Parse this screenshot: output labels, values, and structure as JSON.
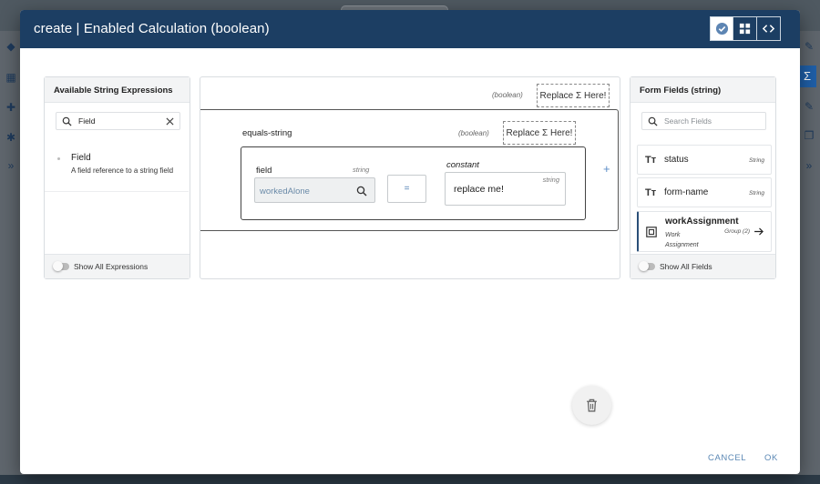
{
  "dialog": {
    "title": "create | Enabled Calculation (boolean)",
    "header_buttons": [
      {
        "icon": "check-circle-icon",
        "active": true
      },
      {
        "icon": "grid-icon",
        "active": false
      },
      {
        "icon": "code-icon",
        "active": false
      }
    ],
    "footer": {
      "cancel_label": "CANCEL",
      "ok_label": "OK"
    }
  },
  "left_panel": {
    "title": "Available String Expressions",
    "search_value": "Field",
    "items": [
      {
        "name": "Field",
        "description": "A field reference to a string field"
      }
    ],
    "toggle_label": "Show All Expressions"
  },
  "center": {
    "outer_type": "(boolean)",
    "outer_replace_label": "Replace Σ Here!",
    "expression": {
      "name": "equals-string",
      "type": "(boolean)",
      "replace_label": "Replace Σ Here!",
      "field_label": "field",
      "field_type": "string",
      "field_value": "workedAlone",
      "operator": "=",
      "constant_label": "constant",
      "constant_type": "string",
      "constant_value": "replace me!",
      "add_symbol": "+"
    }
  },
  "right_panel": {
    "title": "Form Fields (string)",
    "search_placeholder": "Search Fields",
    "fields": [
      {
        "name": "status",
        "type": "String",
        "icon": "text-type-icon"
      },
      {
        "name": "form-name",
        "type": "String",
        "icon": "text-type-icon"
      },
      {
        "name": "workAssignment",
        "subtitle": "Work Assignment",
        "type": "Group (2)",
        "icon": "group-icon"
      }
    ],
    "toggle_label": "Show All Fields"
  },
  "colors": {
    "header_bg": "#1c3e63",
    "accent": "#5b88b5",
    "link_text": "#6a8aa8"
  }
}
